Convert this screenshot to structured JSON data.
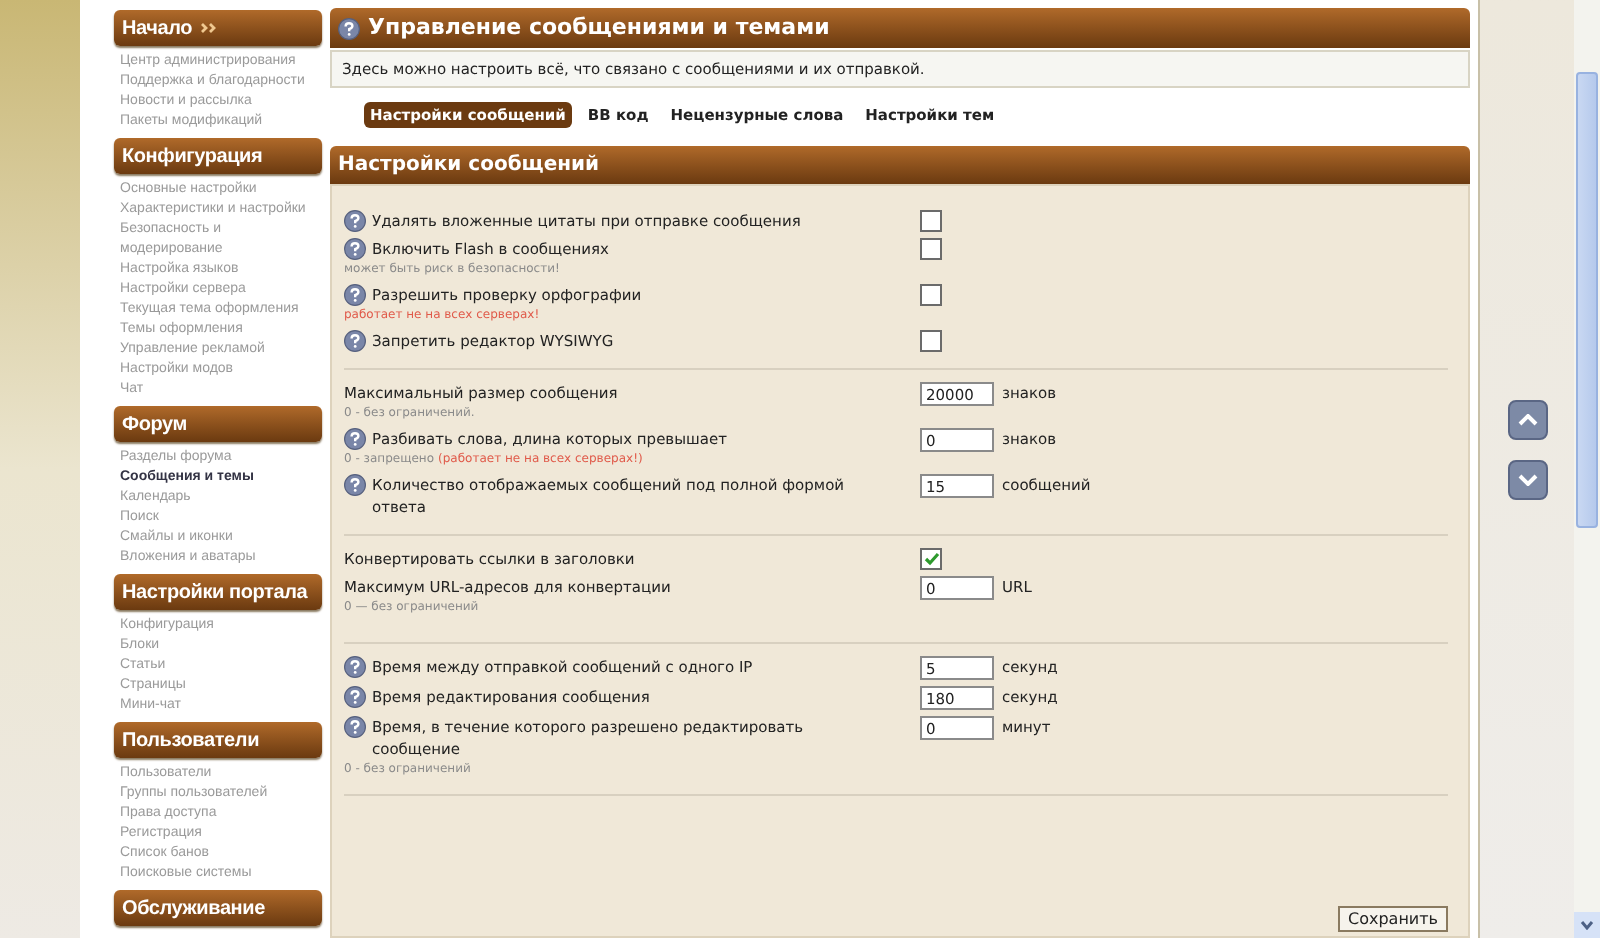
{
  "sidebar": {
    "sections": [
      {
        "title": "Начало",
        "arrows": true,
        "items": [
          {
            "label": "Центр администрирования",
            "selected": false
          },
          {
            "label": "Поддержка и благодарности",
            "selected": false
          },
          {
            "label": "Новости и рассылка",
            "selected": false
          },
          {
            "label": "Пакеты модификаций",
            "selected": false
          }
        ]
      },
      {
        "title": "Конфигурация",
        "arrows": false,
        "items": [
          {
            "label": "Основные настройки",
            "selected": false
          },
          {
            "label": "Характеристики и настройки",
            "selected": false
          },
          {
            "label": "Безопасность и модерирование",
            "selected": false
          },
          {
            "label": "Настройка языков",
            "selected": false
          },
          {
            "label": "Настройки сервера",
            "selected": false
          },
          {
            "label": "Текущая тема оформления",
            "selected": false
          },
          {
            "label": "Темы оформления",
            "selected": false
          },
          {
            "label": "Управление рекламой",
            "selected": false
          },
          {
            "label": "Настройки модов",
            "selected": false
          },
          {
            "label": "Чат",
            "selected": false
          }
        ]
      },
      {
        "title": "Форум",
        "arrows": false,
        "items": [
          {
            "label": "Разделы форума",
            "selected": false
          },
          {
            "label": "Сообщения и темы",
            "selected": true
          },
          {
            "label": "Календарь",
            "selected": false
          },
          {
            "label": "Поиск",
            "selected": false
          },
          {
            "label": "Смайлы и иконки",
            "selected": false
          },
          {
            "label": "Вложения и аватары",
            "selected": false
          }
        ]
      },
      {
        "title": "Настройки портала",
        "arrows": false,
        "items": [
          {
            "label": "Конфигурация",
            "selected": false
          },
          {
            "label": "Блоки",
            "selected": false
          },
          {
            "label": "Статьи",
            "selected": false
          },
          {
            "label": "Страницы",
            "selected": false
          },
          {
            "label": "Мини-чат",
            "selected": false
          }
        ]
      },
      {
        "title": "Пользователи",
        "arrows": false,
        "items": [
          {
            "label": "Пользователи",
            "selected": false
          },
          {
            "label": "Группы пользователей",
            "selected": false
          },
          {
            "label": "Права доступа",
            "selected": false
          },
          {
            "label": "Регистрация",
            "selected": false
          },
          {
            "label": "Список банов",
            "selected": false
          },
          {
            "label": "Поисковые системы",
            "selected": false
          }
        ]
      },
      {
        "title": "Обслуживание",
        "arrows": false
      }
    ]
  },
  "main": {
    "title": "Управление сообщениями и темами",
    "description": "Здесь можно настроить всё, что связано с сообщениями и их отправкой.",
    "tabs": [
      {
        "label": "Настройки сообщений",
        "selected": true
      },
      {
        "label": "BB код",
        "selected": false
      },
      {
        "label": "Нецензурные слова",
        "selected": false
      },
      {
        "label": "Настройки тем",
        "selected": false
      }
    ],
    "section_title": "Настройки сообщений",
    "groups": [
      [
        {
          "kind": "checkbox",
          "help": true,
          "label": "Удалять вложенные цитаты при отправке сообщения",
          "checked": false
        },
        {
          "kind": "checkbox",
          "help": true,
          "label": "Включить Flash в сообщениях",
          "checked": false,
          "note": [
            {
              "text": "может быть риск в безопасности!",
              "warning": false
            }
          ]
        },
        {
          "kind": "checkbox",
          "help": true,
          "label": "Разрешить проверку орфографии",
          "checked": false,
          "note": [
            {
              "text": "работает не на всех серверах!",
              "warning": true
            }
          ]
        },
        {
          "kind": "checkbox",
          "help": true,
          "label": "Запретить редактор WYSIWYG",
          "checked": false
        }
      ],
      [
        {
          "kind": "number",
          "help": false,
          "label": "Максимальный размер сообщения",
          "value": "20000",
          "unit": "знаков",
          "note": [
            {
              "text": "0 - без ограничений.",
              "warning": false
            }
          ]
        },
        {
          "kind": "number",
          "help": true,
          "label": "Разбивать слова, длина которых превышает",
          "value": "0",
          "unit": "знаков",
          "note": [
            {
              "text": "0 - запрещено",
              "warning": false
            },
            {
              "text": "(работает не на всех серверах!)",
              "warning": true
            }
          ]
        },
        {
          "kind": "number",
          "help": true,
          "label": "Количество отображаемых сообщений под полной формой ответа",
          "value": "15",
          "unit": "сообщений"
        }
      ],
      [
        {
          "kind": "checkbox",
          "help": false,
          "label": "Конвертировать ссылки в заголовки",
          "checked": true
        },
        {
          "kind": "number",
          "help": false,
          "label": "Максимум URL-адресов для конвертации",
          "value": "0",
          "unit": "URL",
          "note": [
            {
              "text": "0 — без ограничений",
              "warning": false
            }
          ]
        }
      ],
      [
        {
          "kind": "number",
          "help": true,
          "label": "Время между отправкой сообщений с одного IP",
          "value": "5",
          "unit": "секунд"
        },
        {
          "kind": "number",
          "help": true,
          "label": "Время редактирования сообщения",
          "value": "180",
          "unit": "секунд"
        },
        {
          "kind": "number",
          "help": true,
          "label": "Время, в течение которого разрешено редактировать сообщение",
          "value": "0",
          "unit": "минут",
          "note": [
            {
              "text": "0 - без ограничений",
              "warning": false
            }
          ]
        }
      ]
    ],
    "save_button": "Сохранить"
  }
}
